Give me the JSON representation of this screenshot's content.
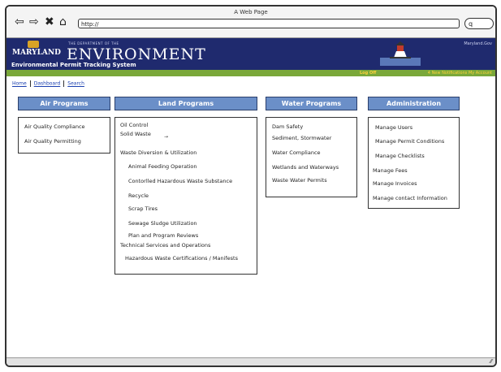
{
  "window": {
    "title": "A Web Page"
  },
  "browser": {
    "address": "http://",
    "search_text": "q"
  },
  "banner": {
    "state": "MARYLAND",
    "department": "THE DEPARTMENT OF THE",
    "agency": "ENVIRONMENT",
    "system": "Environmental Permit Tracking System",
    "site": "Maryland.Gov"
  },
  "userbar": {
    "log_off": "Log Off",
    "links": "4 New Notifications   My Account"
  },
  "breadcrumb": {
    "home": "Home",
    "dashboard": "Dashboard",
    "search": "Search"
  },
  "programs": {
    "air": {
      "title": "Air Programs",
      "items": [
        "Air Quality Compliance",
        "Air Quality Permitting"
      ]
    },
    "land": {
      "title": "Land Programs",
      "items": [
        "Oil Control",
        "Solid Waste",
        "Waste Diversion & Utilization",
        "Animal Feeding Operation",
        "Contorlled Hazardous Waste Substance",
        "Recycle",
        "Scrap Tires",
        "Sewage Sludge Utilization",
        "Plan and Program Reviews",
        "Technical Services and Operations",
        "Hazardous Waste Certifications / Manifests"
      ]
    },
    "water": {
      "title": "Water Programs",
      "items": [
        "Dam Safety",
        "Sediment, Stormwater",
        "Water Compliance",
        "Wetlands and Waterways",
        "Waste Water Permits"
      ]
    },
    "admin": {
      "title": "Administration",
      "items": [
        "Manage Users",
        "Manage Permit Conditions",
        "Manage Checklists",
        "Manage Fees",
        "Manage Invoices",
        "Manage contact Information"
      ]
    }
  },
  "colors": {
    "banner": "#1f2a6e",
    "header": "#6b8fc8",
    "green": "#7aa83a"
  }
}
